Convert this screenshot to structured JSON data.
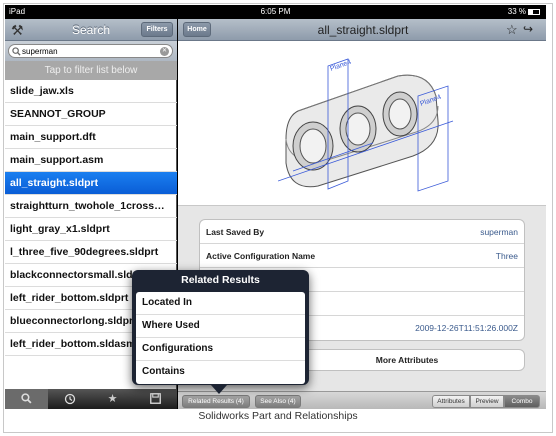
{
  "status_bar": {
    "device": "iPad",
    "time": "6:05 PM",
    "battery": "33 %"
  },
  "sidebar": {
    "title": "Search",
    "filters_label": "Filters",
    "search_value": "superman",
    "filter_hint": "Tap to filter list below",
    "items": [
      "slide_jaw.xls",
      "SEANNOT_GROUP",
      "main_support.dft",
      "main_support.asm",
      "all_straight.sldprt",
      "straightturn_twohole_1cross…",
      "light_gray_x1.sldprt",
      "l_three_five_90degrees.sldprt",
      "blackconnectorsmall.sldprt",
      "left_rider_bottom.sldprt",
      "blueconnectorlong.sldprt",
      "left_rider_bottom.sldasm"
    ],
    "selected_index": 4,
    "tabs": [
      "search-icon",
      "clock-icon",
      "star-icon",
      "save-icon"
    ],
    "active_tab": 0
  },
  "detail": {
    "home_label": "Home",
    "title": "all_straight.sldprt",
    "attributes": [
      {
        "key": "Last Saved By",
        "value": "superman"
      },
      {
        "key": "Active Configuration Name",
        "value": "Three"
      },
      {
        "key": "",
        "value": ""
      },
      {
        "key": "",
        "value": ""
      },
      {
        "key": "",
        "value": "2009-12-26T11:51:26.000Z"
      }
    ],
    "more_attributes_label": "More Attributes",
    "toolbar": {
      "related_label": "Related Results (4)",
      "see_also_label": "See Also (4)",
      "segments": [
        "Attributes",
        "Preview",
        "Combo"
      ],
      "active_segment": 2
    },
    "preview_labels": [
      "Plane4",
      "Plane4"
    ]
  },
  "popover": {
    "title": "Related Results",
    "items": [
      "Located In",
      "Where Used",
      "Configurations",
      "Contains"
    ]
  },
  "caption": "Solidworks Part and Relationships"
}
